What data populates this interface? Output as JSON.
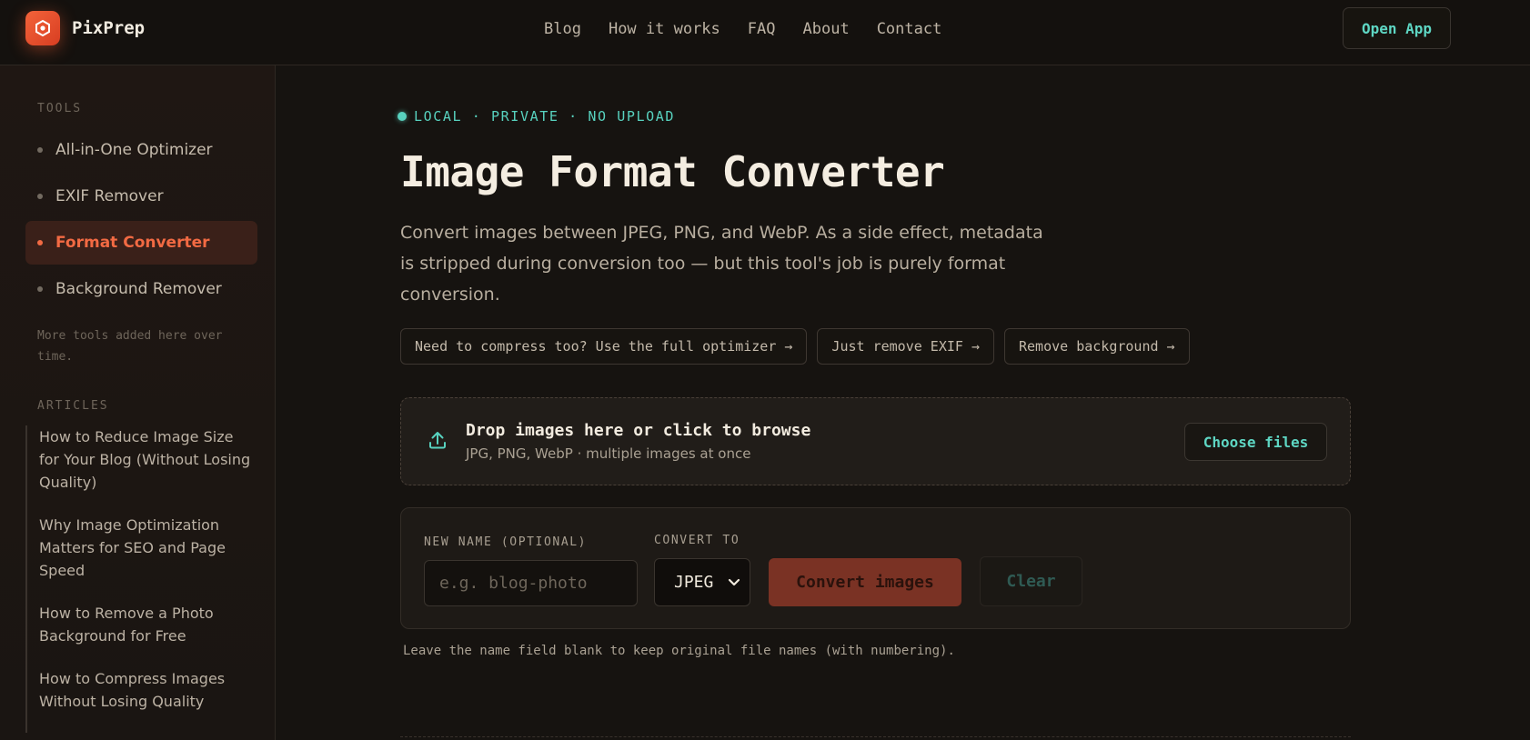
{
  "header": {
    "brand": "PixPrep",
    "nav": [
      "Blog",
      "How it works",
      "FAQ",
      "About",
      "Contact"
    ],
    "open_app": "Open App",
    "logo_icon": "hexagon-logo-icon"
  },
  "sidebar": {
    "tools_heading": "TOOLS",
    "tools": [
      {
        "label": "All-in-One Optimizer",
        "active": false
      },
      {
        "label": "EXIF Remover",
        "active": false
      },
      {
        "label": "Format Converter",
        "active": true
      },
      {
        "label": "Background Remover",
        "active": false
      }
    ],
    "note": "More tools added here over time.",
    "articles_heading": "ARTICLES",
    "articles": [
      "How to Reduce Image Size for Your Blog (Without Losing Quality)",
      "Why Image Optimization Matters for SEO and Page Speed",
      "How to Remove a Photo Background for Free",
      "How to Compress Images Without Losing Quality"
    ]
  },
  "main": {
    "badge": "LOCAL · PRIVATE · NO UPLOAD",
    "title": "Image Format Converter",
    "subtitle": "Convert images between JPEG, PNG, and WebP. As a side effect, metadata is stripped during conversion too — but this tool's job is purely format conversion.",
    "chips": [
      "Need to compress too? Use the full optimizer →",
      "Just remove EXIF →",
      "Remove background →"
    ],
    "dropzone": {
      "title": "Drop images here or click to browse",
      "subtitle": "JPG, PNG, WebP · multiple images at once",
      "button": "Choose files",
      "icon": "upload-icon"
    },
    "form": {
      "name_label": "NEW NAME (OPTIONAL)",
      "name_placeholder": "e.g. blog-photo",
      "convert_label": "CONVERT TO",
      "format_value": "JPEG",
      "convert_button": "Convert images",
      "clear_button": "Clear"
    },
    "hint": "Leave the name field blank to keep original file names (with numbering)."
  },
  "colors": {
    "accent_orange": "#f26a43",
    "accent_teal": "#5ed6c3",
    "background": "#161310"
  }
}
